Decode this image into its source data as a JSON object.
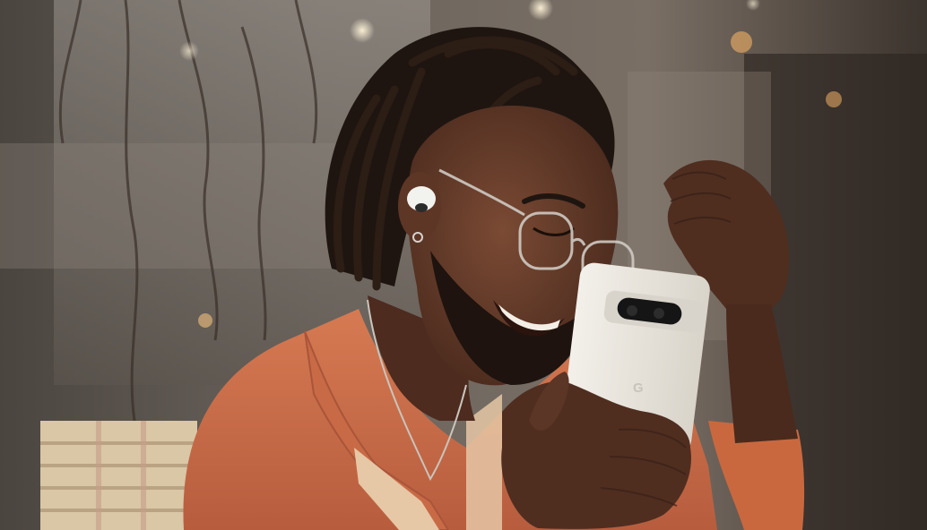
{
  "image": {
    "subject": "smiling-man-with-earbuds-holding-phone",
    "phone_logo_text": "G"
  },
  "colors": {
    "background_dark": "#2e2925",
    "background_mid": "#6b625b",
    "window_light": "#b9b2ab",
    "skin": "#5a3424",
    "skin_highlight": "#7a4a34",
    "hair": "#1f1510",
    "sweater": "#d0714a",
    "sweater_shadow": "#a3543a",
    "collar_stripe": "#e6c7a6",
    "phone_body": "#e9e5dc",
    "phone_camera_bar": "#d8d4cc",
    "earbud": "#f2f2ef",
    "basket": "#d9c7a6"
  }
}
